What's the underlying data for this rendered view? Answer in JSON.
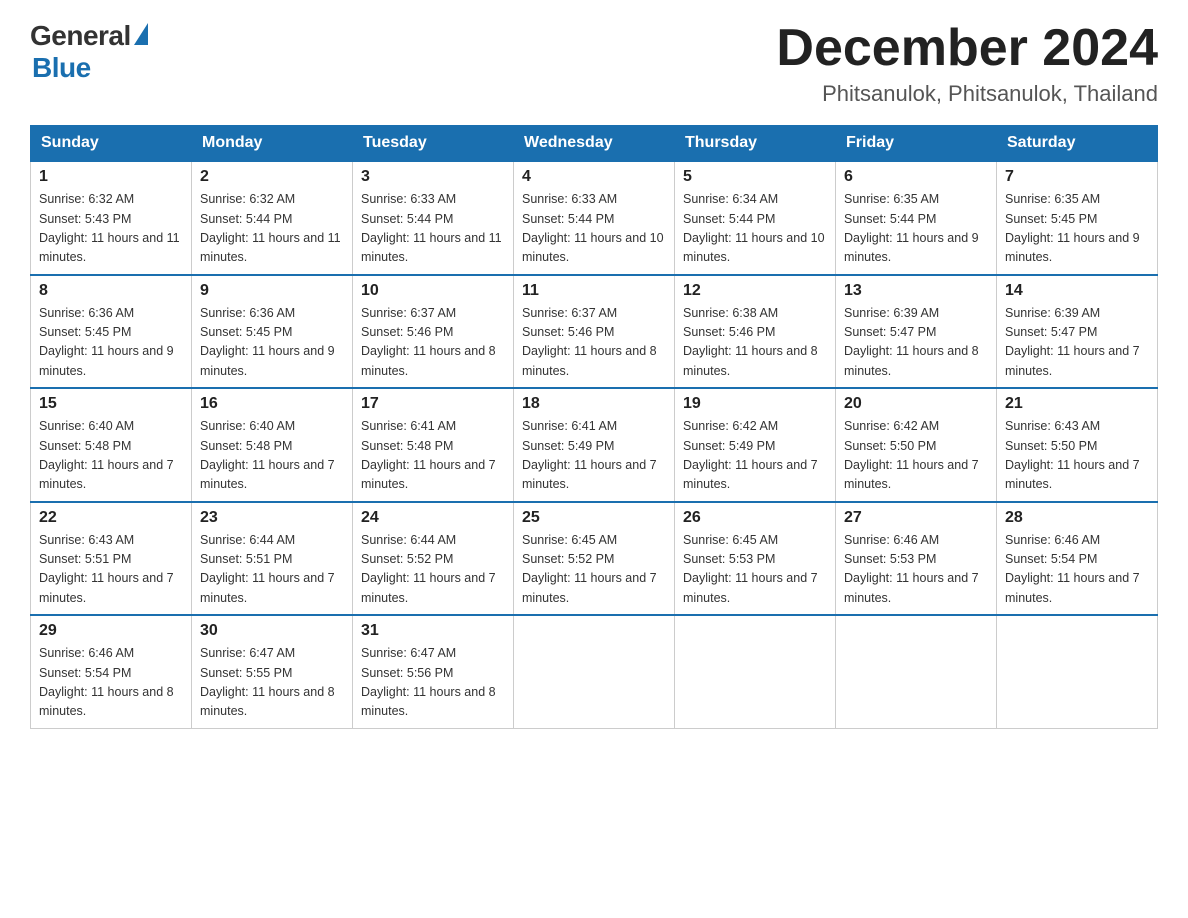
{
  "header": {
    "logo_general": "General",
    "logo_blue": "Blue",
    "month_title": "December 2024",
    "location": "Phitsanulok, Phitsanulok, Thailand"
  },
  "weekdays": [
    "Sunday",
    "Monday",
    "Tuesday",
    "Wednesday",
    "Thursday",
    "Friday",
    "Saturday"
  ],
  "weeks": [
    [
      {
        "day": "1",
        "sunrise": "6:32 AM",
        "sunset": "5:43 PM",
        "daylight": "11 hours and 11 minutes."
      },
      {
        "day": "2",
        "sunrise": "6:32 AM",
        "sunset": "5:44 PM",
        "daylight": "11 hours and 11 minutes."
      },
      {
        "day": "3",
        "sunrise": "6:33 AM",
        "sunset": "5:44 PM",
        "daylight": "11 hours and 11 minutes."
      },
      {
        "day": "4",
        "sunrise": "6:33 AM",
        "sunset": "5:44 PM",
        "daylight": "11 hours and 10 minutes."
      },
      {
        "day": "5",
        "sunrise": "6:34 AM",
        "sunset": "5:44 PM",
        "daylight": "11 hours and 10 minutes."
      },
      {
        "day": "6",
        "sunrise": "6:35 AM",
        "sunset": "5:44 PM",
        "daylight": "11 hours and 9 minutes."
      },
      {
        "day": "7",
        "sunrise": "6:35 AM",
        "sunset": "5:45 PM",
        "daylight": "11 hours and 9 minutes."
      }
    ],
    [
      {
        "day": "8",
        "sunrise": "6:36 AM",
        "sunset": "5:45 PM",
        "daylight": "11 hours and 9 minutes."
      },
      {
        "day": "9",
        "sunrise": "6:36 AM",
        "sunset": "5:45 PM",
        "daylight": "11 hours and 9 minutes."
      },
      {
        "day": "10",
        "sunrise": "6:37 AM",
        "sunset": "5:46 PM",
        "daylight": "11 hours and 8 minutes."
      },
      {
        "day": "11",
        "sunrise": "6:37 AM",
        "sunset": "5:46 PM",
        "daylight": "11 hours and 8 minutes."
      },
      {
        "day": "12",
        "sunrise": "6:38 AM",
        "sunset": "5:46 PM",
        "daylight": "11 hours and 8 minutes."
      },
      {
        "day": "13",
        "sunrise": "6:39 AM",
        "sunset": "5:47 PM",
        "daylight": "11 hours and 8 minutes."
      },
      {
        "day": "14",
        "sunrise": "6:39 AM",
        "sunset": "5:47 PM",
        "daylight": "11 hours and 7 minutes."
      }
    ],
    [
      {
        "day": "15",
        "sunrise": "6:40 AM",
        "sunset": "5:48 PM",
        "daylight": "11 hours and 7 minutes."
      },
      {
        "day": "16",
        "sunrise": "6:40 AM",
        "sunset": "5:48 PM",
        "daylight": "11 hours and 7 minutes."
      },
      {
        "day": "17",
        "sunrise": "6:41 AM",
        "sunset": "5:48 PM",
        "daylight": "11 hours and 7 minutes."
      },
      {
        "day": "18",
        "sunrise": "6:41 AM",
        "sunset": "5:49 PM",
        "daylight": "11 hours and 7 minutes."
      },
      {
        "day": "19",
        "sunrise": "6:42 AM",
        "sunset": "5:49 PM",
        "daylight": "11 hours and 7 minutes."
      },
      {
        "day": "20",
        "sunrise": "6:42 AM",
        "sunset": "5:50 PM",
        "daylight": "11 hours and 7 minutes."
      },
      {
        "day": "21",
        "sunrise": "6:43 AM",
        "sunset": "5:50 PM",
        "daylight": "11 hours and 7 minutes."
      }
    ],
    [
      {
        "day": "22",
        "sunrise": "6:43 AM",
        "sunset": "5:51 PM",
        "daylight": "11 hours and 7 minutes."
      },
      {
        "day": "23",
        "sunrise": "6:44 AM",
        "sunset": "5:51 PM",
        "daylight": "11 hours and 7 minutes."
      },
      {
        "day": "24",
        "sunrise": "6:44 AM",
        "sunset": "5:52 PM",
        "daylight": "11 hours and 7 minutes."
      },
      {
        "day": "25",
        "sunrise": "6:45 AM",
        "sunset": "5:52 PM",
        "daylight": "11 hours and 7 minutes."
      },
      {
        "day": "26",
        "sunrise": "6:45 AM",
        "sunset": "5:53 PM",
        "daylight": "11 hours and 7 minutes."
      },
      {
        "day": "27",
        "sunrise": "6:46 AM",
        "sunset": "5:53 PM",
        "daylight": "11 hours and 7 minutes."
      },
      {
        "day": "28",
        "sunrise": "6:46 AM",
        "sunset": "5:54 PM",
        "daylight": "11 hours and 7 minutes."
      }
    ],
    [
      {
        "day": "29",
        "sunrise": "6:46 AM",
        "sunset": "5:54 PM",
        "daylight": "11 hours and 8 minutes."
      },
      {
        "day": "30",
        "sunrise": "6:47 AM",
        "sunset": "5:55 PM",
        "daylight": "11 hours and 8 minutes."
      },
      {
        "day": "31",
        "sunrise": "6:47 AM",
        "sunset": "5:56 PM",
        "daylight": "11 hours and 8 minutes."
      },
      null,
      null,
      null,
      null
    ]
  ]
}
